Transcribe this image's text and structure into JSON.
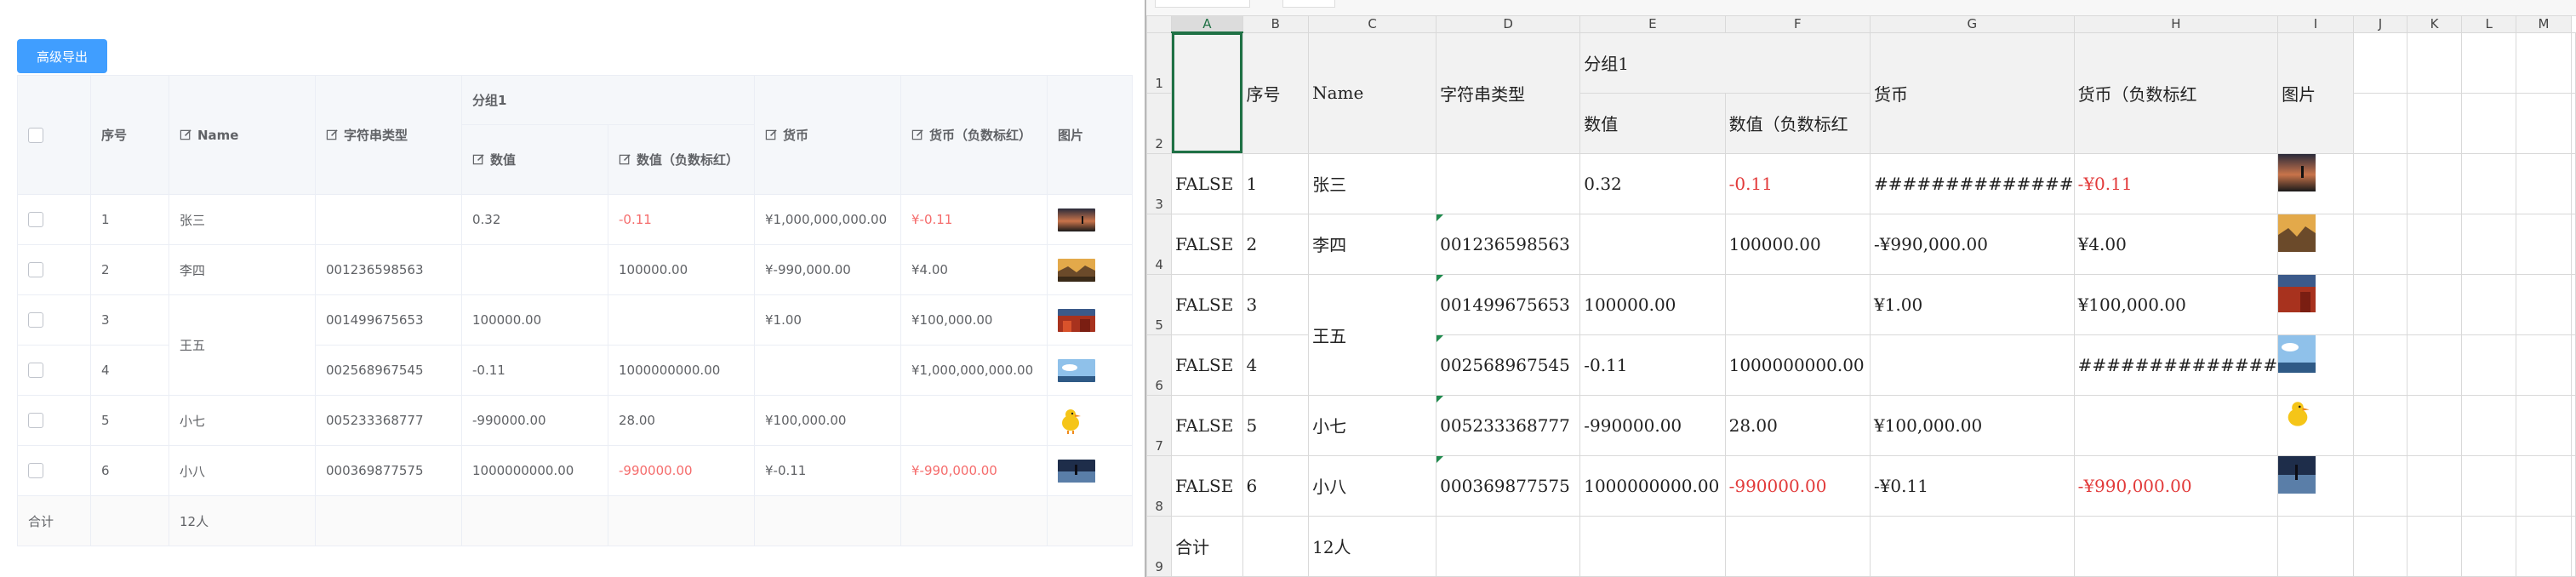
{
  "grid": {
    "export_button": "高级导出",
    "headers": {
      "index": "序号",
      "name": "Name",
      "str_type": "字符串类型",
      "group": "分组1",
      "number": "数值",
      "number_neg": "数值（负数标红）",
      "currency": "货币",
      "currency_neg": "货币（负数标红）",
      "image": "图片"
    },
    "rows": [
      {
        "index": "1",
        "name": "张三",
        "str": "",
        "num": "0.32",
        "num_neg": "-0.11",
        "cur": "¥1,000,000,000.00",
        "cur_neg": "¥-0.11",
        "image": "dusk-figure"
      },
      {
        "index": "2",
        "name": "李四",
        "str": "001236598563",
        "num": "",
        "num_neg": "100000.00",
        "cur": "¥-990,000.00",
        "cur_neg": "¥4.00",
        "image": "mountain-sunset"
      },
      {
        "index": "3",
        "name": "王五",
        "str": "001499675653",
        "num": "100000.00",
        "num_neg": "",
        "cur": "¥1.00",
        "cur_neg": "¥100,000.00",
        "image": "red-forest"
      },
      {
        "index": "4",
        "name": "王五",
        "str": "002568967545",
        "num": "-0.11",
        "num_neg": "1000000000.00",
        "cur": "",
        "cur_neg": "¥1,000,000,000.00",
        "image": "blue-sky"
      },
      {
        "index": "5",
        "name": "小七",
        "str": "005233368777",
        "num": "-990000.00",
        "num_neg": "28.00",
        "cur": "¥100,000.00",
        "cur_neg": "",
        "image": "yellow-duck"
      },
      {
        "index": "6",
        "name": "小八",
        "str": "000369877575",
        "num": "1000000000.00",
        "num_neg": "-990000.00",
        "cur": "¥-0.11",
        "cur_neg": "¥-990,000.00",
        "image": "lake-night"
      }
    ],
    "summary": {
      "label": "合计",
      "name": "12人"
    }
  },
  "sheet": {
    "columns": [
      "A",
      "B",
      "C",
      "D",
      "E",
      "F",
      "G",
      "H",
      "I",
      "J",
      "K",
      "L",
      "M"
    ],
    "row_numbers": [
      "1",
      "2",
      "3",
      "4",
      "5",
      "6",
      "7",
      "8",
      "9"
    ],
    "headers": {
      "index": "序号",
      "name": "Name",
      "str_type": "字符串类型",
      "group": "分组1",
      "number": "数值",
      "number_neg": "数值（负数标红",
      "currency": "货币",
      "currency_neg": "货币（负数标红",
      "image": "图片"
    },
    "rows": [
      {
        "a": "FALSE",
        "b": "1",
        "c": "张三",
        "d": "",
        "e": "0.32",
        "f": "-0.11",
        "g": "##############",
        "h": "-¥0.11"
      },
      {
        "a": "FALSE",
        "b": "2",
        "c": "李四",
        "d": "001236598563",
        "e": "",
        "f": "100000.00",
        "g": "-¥990,000.00",
        "h": "¥4.00"
      },
      {
        "a": "FALSE",
        "b": "3",
        "c": "王五",
        "d": "001499675653",
        "e": "100000.00",
        "f": "",
        "g": "¥1.00",
        "h": "¥100,000.00"
      },
      {
        "a": "FALSE",
        "b": "4",
        "c": "",
        "d": "002568967545",
        "e": "-0.11",
        "f": "1000000000.00",
        "g": "",
        "h": "##############"
      },
      {
        "a": "FALSE",
        "b": "5",
        "c": "小七",
        "d": "005233368777",
        "e": "-990000.00",
        "f": "28.00",
        "g": "¥100,000.00",
        "h": ""
      },
      {
        "a": "FALSE",
        "b": "6",
        "c": "小八",
        "d": "000369877575",
        "e": "1000000000.00",
        "f": "-990000.00",
        "g": "-¥0.11",
        "h": "-¥990,000.00"
      }
    ],
    "summary": {
      "label": "合计",
      "name": "12人"
    }
  },
  "colors": {
    "primary": "#409eff",
    "negative": "#f56c6c",
    "excel_green": "#1f7145"
  }
}
